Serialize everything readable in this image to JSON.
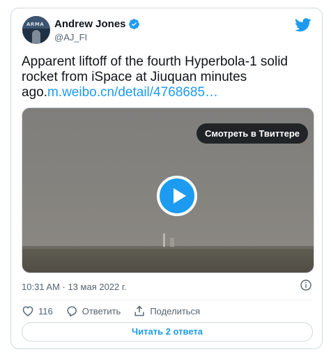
{
  "author": {
    "name": "Andrew Jones",
    "handle": "@AJ_FI",
    "avatar_text": "ARMA"
  },
  "tweet": {
    "text": "Apparent liftoff of the fourth Hyperbola-1 solid rocket from iSpace at Jiuquan minutes ago.",
    "link": "m.weibo.cn/detail/4768685…"
  },
  "media": {
    "watch_label": "Смотреть в Твиттере"
  },
  "timestamp": "10:31 AM · 13 мая 2022 г.",
  "actions": {
    "likes": "116",
    "reply_label": "Ответить",
    "share_label": "Поделиться"
  },
  "read_replies_label": "Читать 2 ответа",
  "colors": {
    "accent": "#1d9bf0",
    "muted": "#536471",
    "border": "#cfd9de"
  },
  "icons": [
    "verified-badge-icon",
    "twitter-bird-icon",
    "play-icon",
    "info-icon",
    "heart-icon",
    "reply-icon",
    "share-icon"
  ]
}
